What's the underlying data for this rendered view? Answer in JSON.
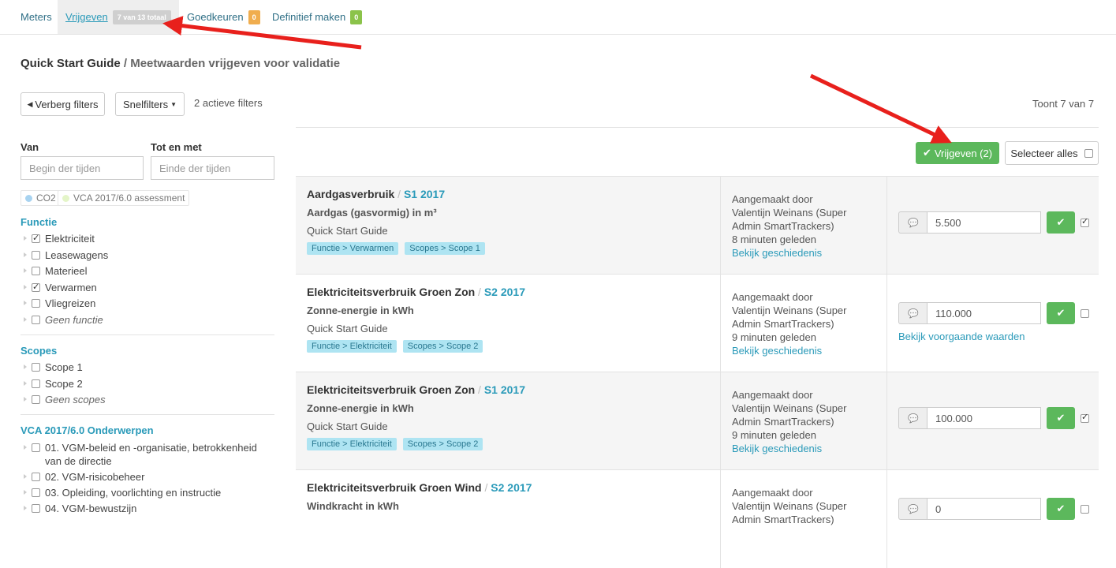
{
  "topnav": {
    "tabs": [
      {
        "label": "Meters"
      },
      {
        "label": "Vrijgeven",
        "badge": "7 van 13 totaal"
      },
      {
        "label": "Goedkeuren",
        "badge": "0"
      },
      {
        "label": "Definitief maken",
        "badge": "0"
      }
    ]
  },
  "header": {
    "title_main": "Quick Start Guide",
    "title_rest": " / Meetwaarden vrijgeven voor validatie"
  },
  "toolbar": {
    "hide_filters": "Verberg filters",
    "quick_filters": "Snelfilters",
    "active_filters": "2 actieve filters",
    "showing": "Toont 7 van 7"
  },
  "sidebar": {
    "from_label": "Van",
    "to_label": "Tot en met",
    "from_placeholder": "Begin der tijden",
    "to_placeholder": "Einde der tijden",
    "chips": [
      {
        "label": "CO2",
        "color": "#a8d3f0"
      },
      {
        "label": "VCA 2017/6.0 assessment",
        "color": "#e4f5c8"
      }
    ],
    "functie_title": "Functie",
    "functie": [
      {
        "label": "Elektriciteit",
        "checked": true
      },
      {
        "label": "Leasewagens",
        "checked": false
      },
      {
        "label": "Materieel",
        "checked": false
      },
      {
        "label": "Verwarmen",
        "checked": true
      },
      {
        "label": "Vliegreizen",
        "checked": false
      },
      {
        "label": "Geen functie",
        "checked": false
      }
    ],
    "scopes_title": "Scopes",
    "scopes": [
      {
        "label": "Scope 1",
        "checked": false
      },
      {
        "label": "Scope 2",
        "checked": false
      },
      {
        "label": "Geen scopes",
        "checked": false
      }
    ],
    "vca_title": "VCA 2017/6.0 Onderwerpen",
    "vca": [
      {
        "label": "01. VGM-beleid en -organisatie, betrokkenheid van de directie"
      },
      {
        "label": "02. VGM-risicobeheer"
      },
      {
        "label": "03. Opleiding, voorlichting en instructie"
      },
      {
        "label": "04. VGM-bewustzijn"
      }
    ]
  },
  "actions": {
    "release_button": "Vrijgeven (2)",
    "select_all": "Selecteer alles"
  },
  "rows": [
    {
      "name": "Aardgasverbruik",
      "period": "S1 2017",
      "unit": "Aardgas (gasvormig) in m³",
      "org": "Quick Start Guide",
      "tags": [
        "Functie > Verwarmen",
        "Scopes > Scope 1"
      ],
      "created_label": "Aangemaakt door",
      "creator": "Valentijn Weinans (Super Admin SmartTrackers)",
      "when": "8 minuten geleden",
      "history": "Bekijk geschiedenis",
      "value": "5.500",
      "checked": true,
      "prev": ""
    },
    {
      "name": "Elektriciteitsverbruik Groen Zon",
      "period": "S2 2017",
      "unit": "Zonne-energie in kWh",
      "org": "Quick Start Guide",
      "tags": [
        "Functie > Elektriciteit",
        "Scopes > Scope 2"
      ],
      "created_label": "Aangemaakt door",
      "creator": "Valentijn Weinans (Super Admin SmartTrackers)",
      "when": "9 minuten geleden",
      "history": "Bekijk geschiedenis",
      "value": "110.000",
      "checked": false,
      "prev": "Bekijk voorgaande waarden"
    },
    {
      "name": "Elektriciteitsverbruik Groen Zon",
      "period": "S1 2017",
      "unit": "Zonne-energie in kWh",
      "org": "Quick Start Guide",
      "tags": [
        "Functie > Elektriciteit",
        "Scopes > Scope 2"
      ],
      "created_label": "Aangemaakt door",
      "creator": "Valentijn Weinans (Super Admin SmartTrackers)",
      "when": "9 minuten geleden",
      "history": "Bekijk geschiedenis",
      "value": "100.000",
      "checked": true,
      "prev": ""
    },
    {
      "name": "Elektriciteitsverbruik Groen Wind",
      "period": "S2 2017",
      "unit": "Windkracht in kWh",
      "org": "",
      "tags": [],
      "created_label": "Aangemaakt door",
      "creator": "Valentijn Weinans (Super Admin SmartTrackers)",
      "when": "",
      "history": "",
      "value": "0",
      "checked": false,
      "prev": ""
    }
  ],
  "colors": {
    "accent": "#2a9ab9",
    "success": "#5cb85c",
    "annotation_arrow": "#e8201c"
  }
}
